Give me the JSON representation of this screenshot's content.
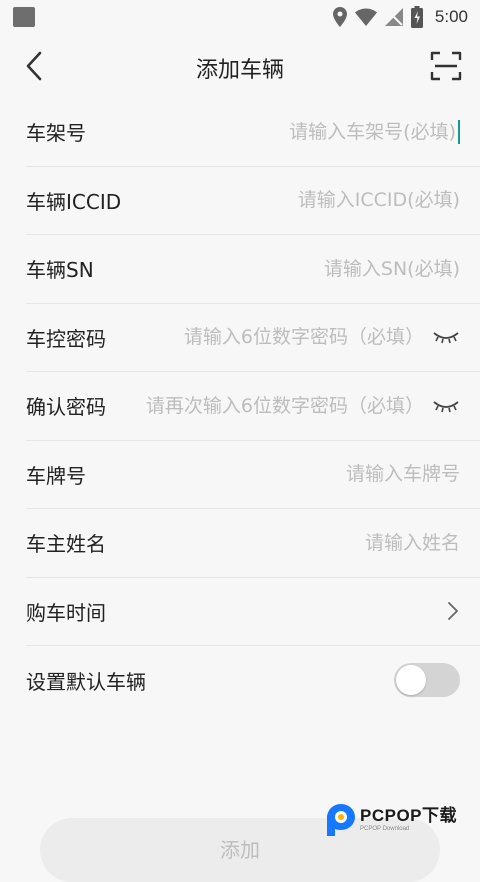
{
  "status_bar": {
    "time": "5:00"
  },
  "header": {
    "title": "添加车辆"
  },
  "form": {
    "rows": [
      {
        "label": "车架号",
        "placeholder": "请输入车架号(必填)"
      },
      {
        "label": "车辆ICCID",
        "placeholder": "请输入ICCID(必填)"
      },
      {
        "label": "车辆SN",
        "placeholder": "请输入SN(必填)"
      },
      {
        "label": "车控密码",
        "placeholder": "请输入6位数字密码（必填）"
      },
      {
        "label": "确认密码",
        "placeholder": "请再次输入6位数字密码（必填）"
      },
      {
        "label": "车牌号",
        "placeholder": "请输入车牌号"
      },
      {
        "label": "车主姓名",
        "placeholder": "请输入姓名"
      },
      {
        "label": "购车时间"
      },
      {
        "label": "设置默认车辆",
        "toggle_on": false
      }
    ]
  },
  "submit": {
    "label": "添加"
  },
  "watermark": {
    "brand": "PCPOP下载",
    "sub": "PCPOP Download"
  },
  "colors": {
    "accent": "#0f9d8f",
    "placeholder": "#bdbdbd",
    "background": "#f7f7f7"
  }
}
